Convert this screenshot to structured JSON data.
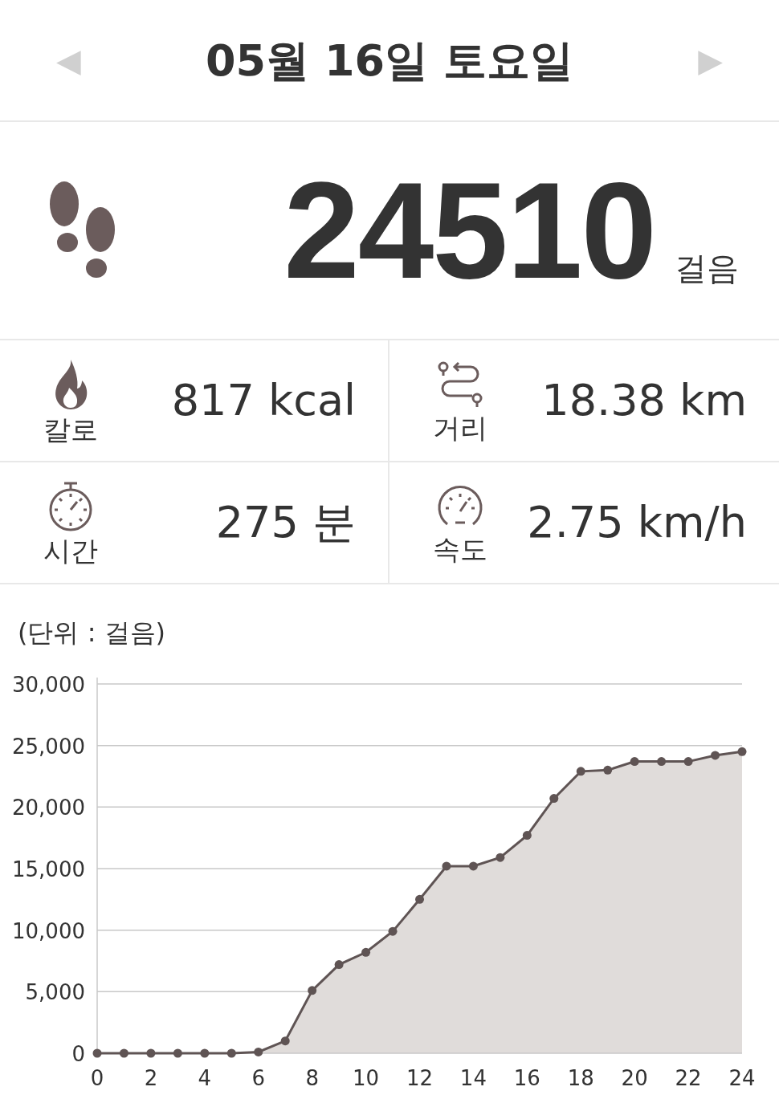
{
  "header": {
    "date": "05월 16일 토요일",
    "prev": "◀",
    "next": "▶"
  },
  "steps": {
    "count": "24510",
    "unit": "걸음"
  },
  "stats": [
    {
      "kind": "calories",
      "label": "칼로",
      "value": "817 kcal"
    },
    {
      "kind": "distance",
      "label": "거리",
      "value": "18.38 km"
    },
    {
      "kind": "time",
      "label": "시간",
      "value": "275 분"
    },
    {
      "kind": "speed",
      "label": "속도",
      "value": "2.75 km/h"
    }
  ],
  "chart": {
    "unit_label": "(단위 : 걸음)",
    "chart_data": {
      "type": "area",
      "x": [
        0,
        1,
        2,
        3,
        4,
        5,
        6,
        7,
        8,
        9,
        10,
        11,
        12,
        13,
        14,
        15,
        16,
        17,
        18,
        19,
        20,
        21,
        22,
        23,
        24
      ],
      "grid": true,
      "series": [
        {
          "color": "#5f5454",
          "values": [
            0,
            0,
            0,
            0,
            0,
            0,
            100,
            1000,
            5100,
            7200,
            8200,
            9900,
            12500,
            15200,
            15200,
            15900,
            17700,
            20700,
            22900,
            23000,
            23700,
            23700,
            23700,
            24200,
            24500
          ]
        }
      ],
      "ylim": [
        0,
        30000
      ],
      "xlim": [
        0,
        24
      ],
      "yticks": [
        {
          "value": 0,
          "label": "0"
        },
        {
          "value": 5000,
          "label": "5,000"
        },
        {
          "value": 10000,
          "label": "10,000"
        },
        {
          "value": 15000,
          "label": "15,000"
        },
        {
          "value": 20000,
          "label": "20,000"
        },
        {
          "value": 25000,
          "label": "25,000"
        },
        {
          "value": 30000,
          "label": "30,000"
        }
      ],
      "xticks": [
        0,
        2,
        4,
        6,
        8,
        10,
        12,
        14,
        16,
        18,
        20,
        22,
        24
      ]
    }
  }
}
